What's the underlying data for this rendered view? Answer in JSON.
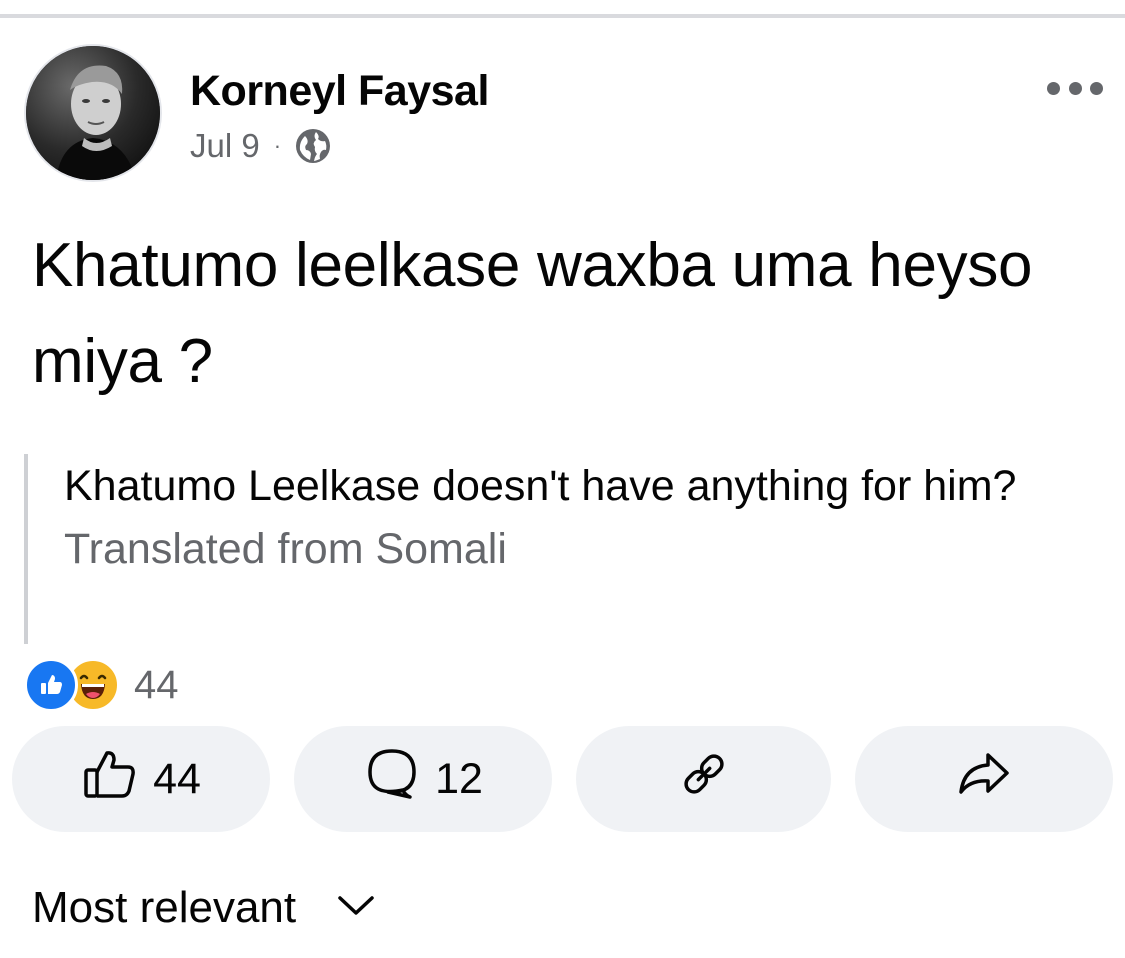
{
  "post": {
    "author": "Korneyl Faysal",
    "date": "Jul 9",
    "separator": "·",
    "audience_icon": "globe-icon",
    "text": "Khatumo leelkase waxba uma heyso miya ?",
    "translation": "Khatumo Leelkase doesn't have anything for him?",
    "translation_note": "Translated from Somali"
  },
  "reactions": {
    "icons": [
      "like-reaction-icon",
      "haha-reaction-icon"
    ],
    "count": "44"
  },
  "actions": {
    "like_count": "44",
    "comment_count": "12",
    "copy_link_icon": "link-icon",
    "share_icon": "share-icon"
  },
  "comments": {
    "sort_label": "Most relevant"
  },
  "colors": {
    "secondary_text": "#65676b",
    "button_bg": "#f0f2f5",
    "like_blue": "#1877f2",
    "haha_yellow": "#f7b928"
  }
}
